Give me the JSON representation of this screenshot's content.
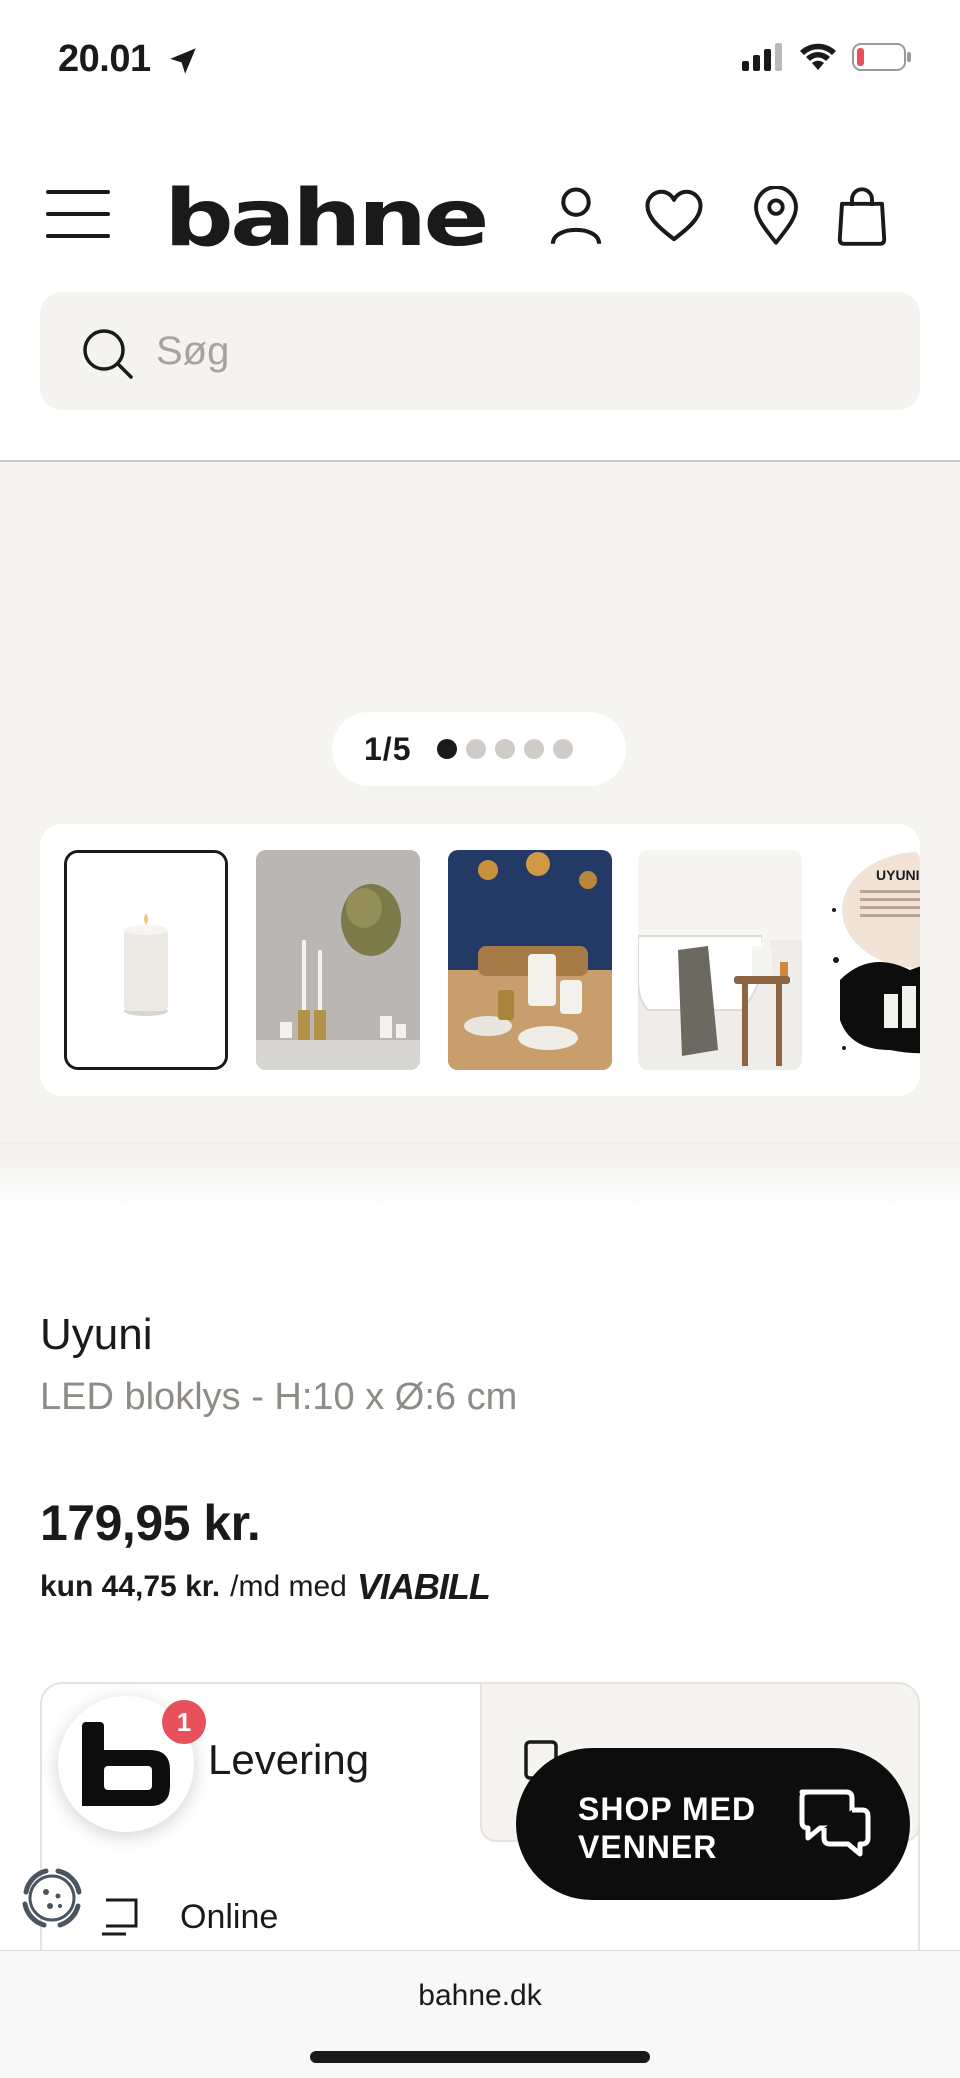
{
  "status_bar": {
    "time": "20.01"
  },
  "header": {
    "logo": "bahne"
  },
  "search": {
    "placeholder": "Søg"
  },
  "gallery": {
    "pager": "1/5",
    "current": 1,
    "total": 5,
    "thumbnails": [
      {
        "name": "thumb-candle"
      },
      {
        "name": "thumb-candlesticks"
      },
      {
        "name": "thumb-table-setting"
      },
      {
        "name": "thumb-bathtub"
      },
      {
        "name": "thumb-info-sheet",
        "text": "UYUNI L"
      }
    ]
  },
  "product": {
    "name": "Uyuni",
    "subtitle": "LED bloklys - H:10 x Ø:6 cm",
    "price": "179,95 kr.",
    "installment_amount": "kun 44,75 kr.",
    "installment_text": "/md med",
    "installment_brand": "VIABILL"
  },
  "delivery": {
    "levering_label": "Levering",
    "online_label": "Online"
  },
  "chat": {
    "notification_count": "1",
    "shop_button": "SHOP MED VENNER"
  },
  "browser": {
    "url": "bahne.dk"
  },
  "colors": {
    "accent": "#1a1a1a",
    "badge": "#e8505b",
    "surface": "#f6f4f1"
  }
}
